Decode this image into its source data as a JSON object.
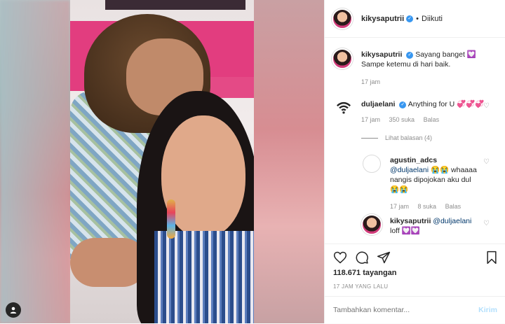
{
  "post": {
    "username": "kikysaputrii",
    "separator": "•",
    "follow_status": "Diikuti",
    "verified": true
  },
  "caption": {
    "username": "kikysaputrii",
    "text_line1": "Sayang banget 💟",
    "text_line2": "Sampe ketemu di hari baik.",
    "time": "17 jam"
  },
  "comments": [
    {
      "username": "duljaelani",
      "text": "Anything for U 💞💞💞",
      "time": "17 jam",
      "likes": "350 suka",
      "reply": "Balas",
      "view_replies": "Lihat balasan (4)"
    }
  ],
  "replies": [
    {
      "username": "agustin_adcs",
      "mention": "@duljaelani",
      "text_a": "😭😭 whaaaa",
      "text_b": "nangis dipojokan aku dul",
      "text_c": "😭😭",
      "time": "17 jam",
      "likes": "8 suka",
      "reply": "Balas"
    },
    {
      "username": "kikysaputrii",
      "mention": "@duljaelani",
      "text": "loff 💟💟"
    }
  ],
  "actions": {
    "views": "118.671 tayangan",
    "time_ago": "17 JAM YANG LALU",
    "comment_placeholder": "Tambahkan komentar...",
    "send_label": "Kirim"
  },
  "colors": {
    "verified_blue": "#3897f0",
    "send_disabled": "#b2dffc",
    "meta_gray": "#8e8e8e"
  }
}
